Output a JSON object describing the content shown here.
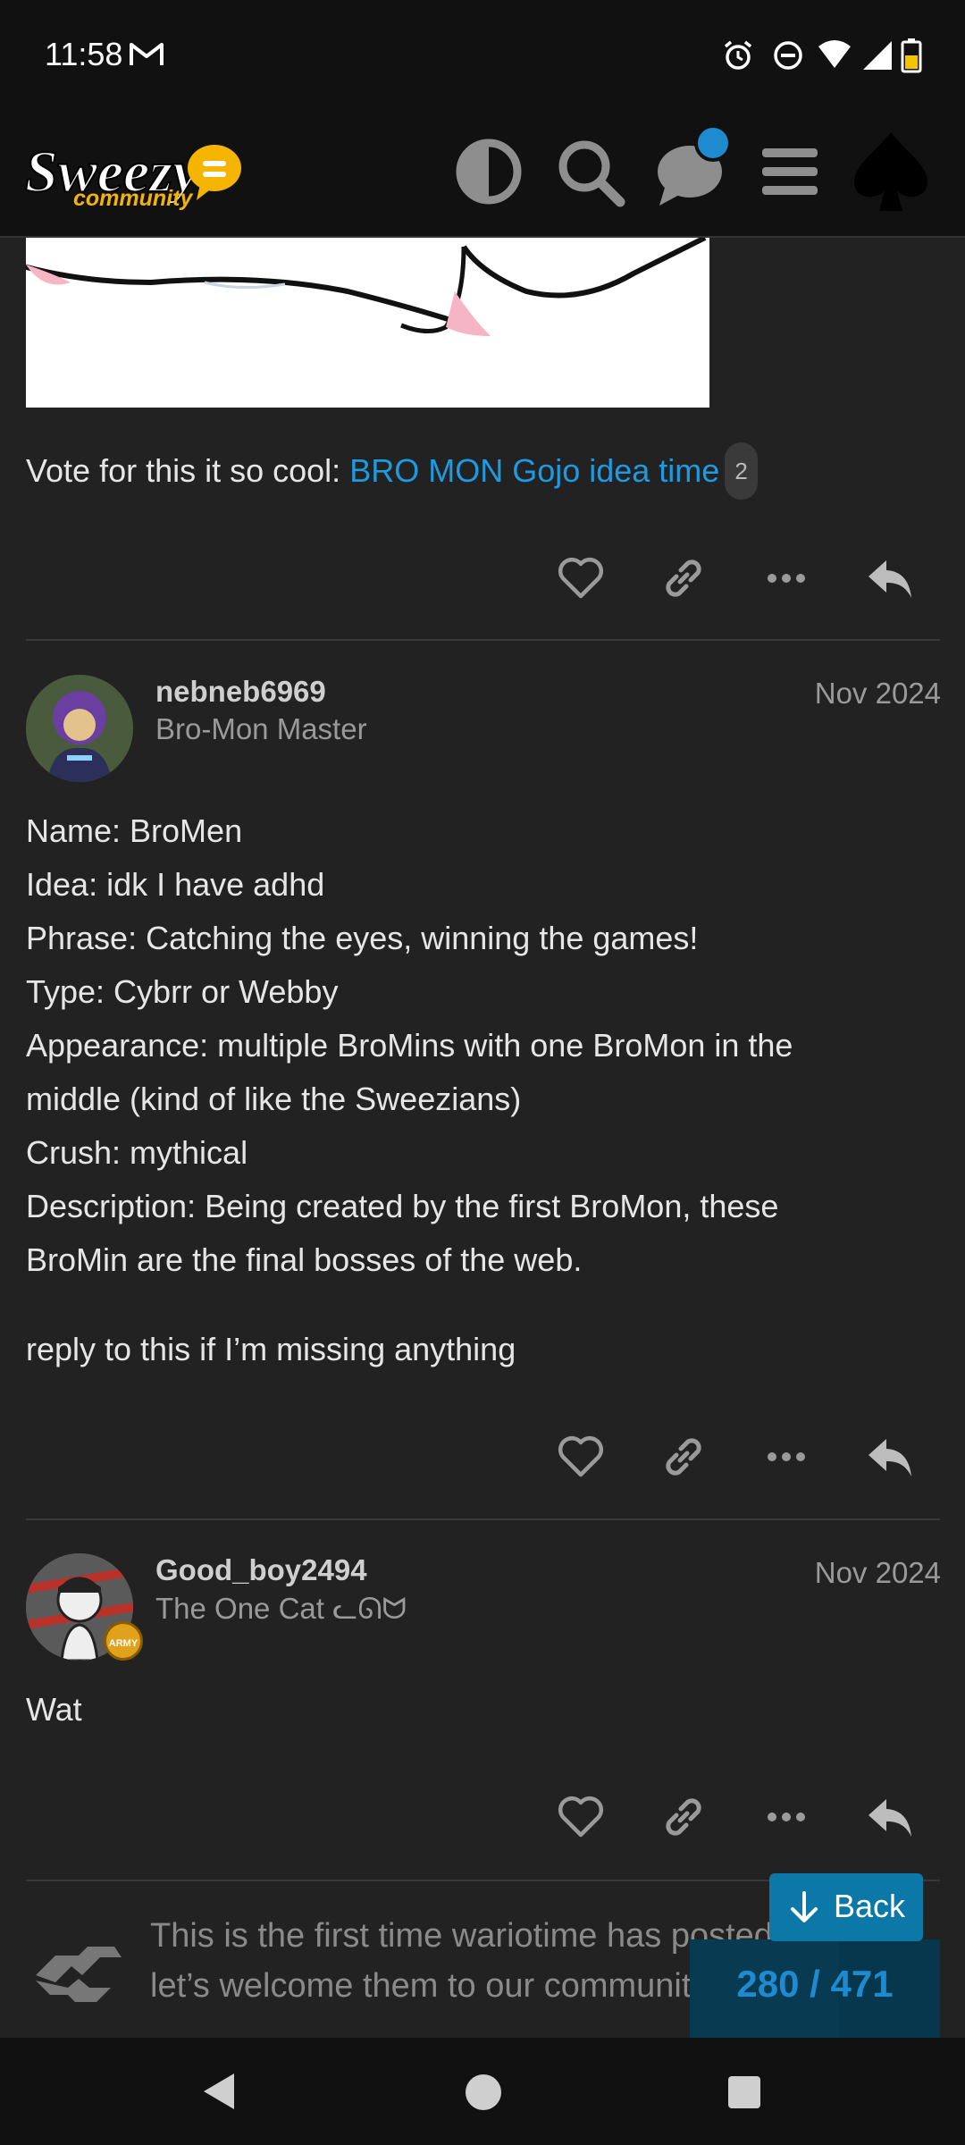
{
  "status": {
    "time": "11:58"
  },
  "header": {
    "logo_sub": "community"
  },
  "post1": {
    "vote_prefix": "Vote for this it so cool: ",
    "link_text": "BRO MON Gojo idea time",
    "link_badge": "2"
  },
  "post2": {
    "username": "nebneb6969",
    "user_title": "Bro-Mon Master",
    "date": "Nov 2024",
    "lines": [
      "Name: BroMen",
      "Idea: idk I have adhd",
      "Phrase: Catching the eyes, winning the games!",
      "Type: Cybrr or Webby",
      "Appearance: multiple BroMins with one BroMon in the",
      "middle (kind of like the Sweezians)",
      "Crush: mythical",
      "Description: Being created by the first BroMon, these",
      "BroMin are the final bosses of the web."
    ],
    "footer_line": "reply to this if I’m missing anything"
  },
  "post3": {
    "username": "Good_boy2494",
    "user_title": "The One Cat ᓚᘏᗢ",
    "date": "Nov 2024",
    "body": "Wat",
    "avatar_badge": "ARMY"
  },
  "welcome": {
    "line1": "This is the first time wariotime has posted",
    "line2": "let’s welcome them to our community!"
  },
  "timeline": {
    "back_label": "Back",
    "progress": "280 / 471"
  },
  "colors": {
    "background": "#222222",
    "link": "#1e9ae0",
    "accent": "#0b78a8",
    "notification_dot": "#1e8ad0"
  }
}
